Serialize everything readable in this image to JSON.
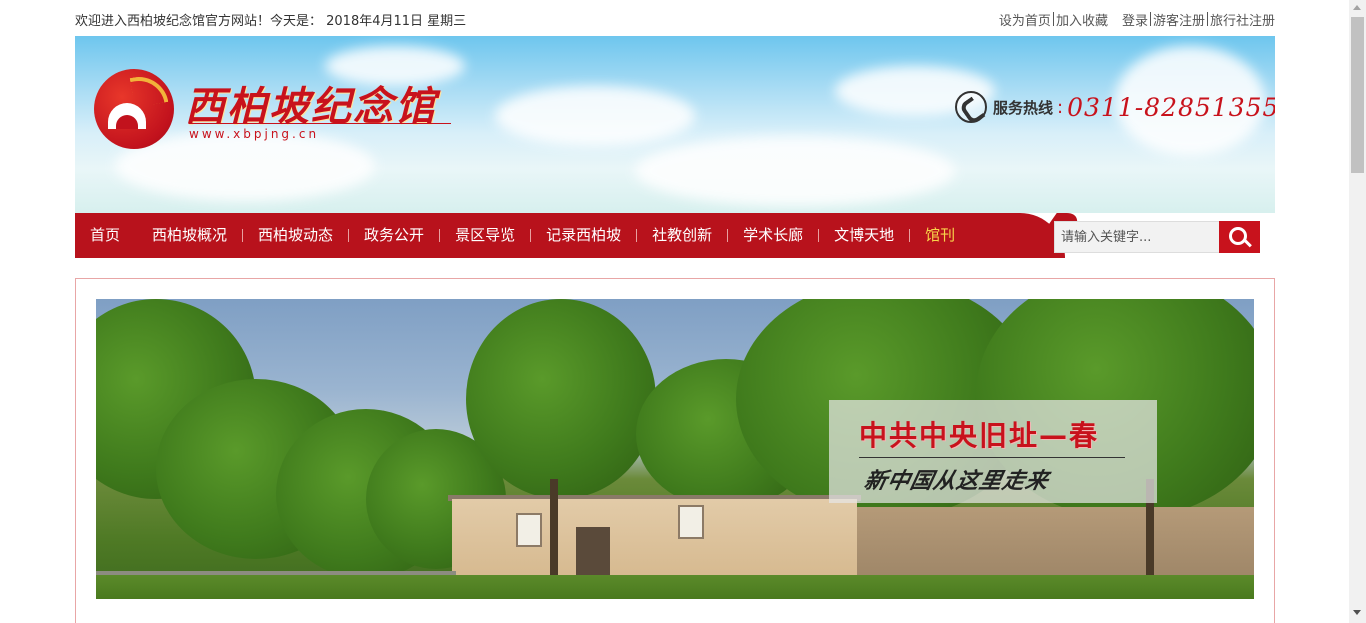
{
  "topbar": {
    "welcome": "欢迎进入西柏坡纪念馆官方网站！今天是： 2018年4月11日 星期三",
    "links": {
      "set_home": "设为首页",
      "add_favorite": "加入收藏",
      "login": "登录",
      "visitor_register": "游客注册",
      "agency_register": "旅行社注册"
    }
  },
  "header": {
    "logo_text": "西柏坡纪念馆",
    "logo_url": "www.xbpjng.cn",
    "hotline_label": "服务热线",
    "hotline_colon": ":",
    "hotline_number": "0311-82851355"
  },
  "nav": {
    "items": [
      {
        "label": "首页"
      },
      {
        "label": "西柏坡概况"
      },
      {
        "label": "西柏坡动态"
      },
      {
        "label": "政务公开"
      },
      {
        "label": "景区导览"
      },
      {
        "label": "记录西柏坡"
      },
      {
        "label": "社教创新"
      },
      {
        "label": "学术长廊"
      },
      {
        "label": "文博天地"
      },
      {
        "label": "馆刊"
      }
    ],
    "active_index": 9,
    "active_color": "#f8d34a",
    "background_color": "#b8121c"
  },
  "search": {
    "placeholder": "请输入关键字..."
  },
  "slide": {
    "title": "中共中央旧址—春",
    "subtitle": "新中国从这里走来"
  },
  "colors": {
    "brand_red": "#c8121c",
    "content_border": "#e8a6a6"
  },
  "icons": {
    "phone": "phone-icon",
    "search": "search-icon",
    "logo": "logo-emblem-icon"
  }
}
